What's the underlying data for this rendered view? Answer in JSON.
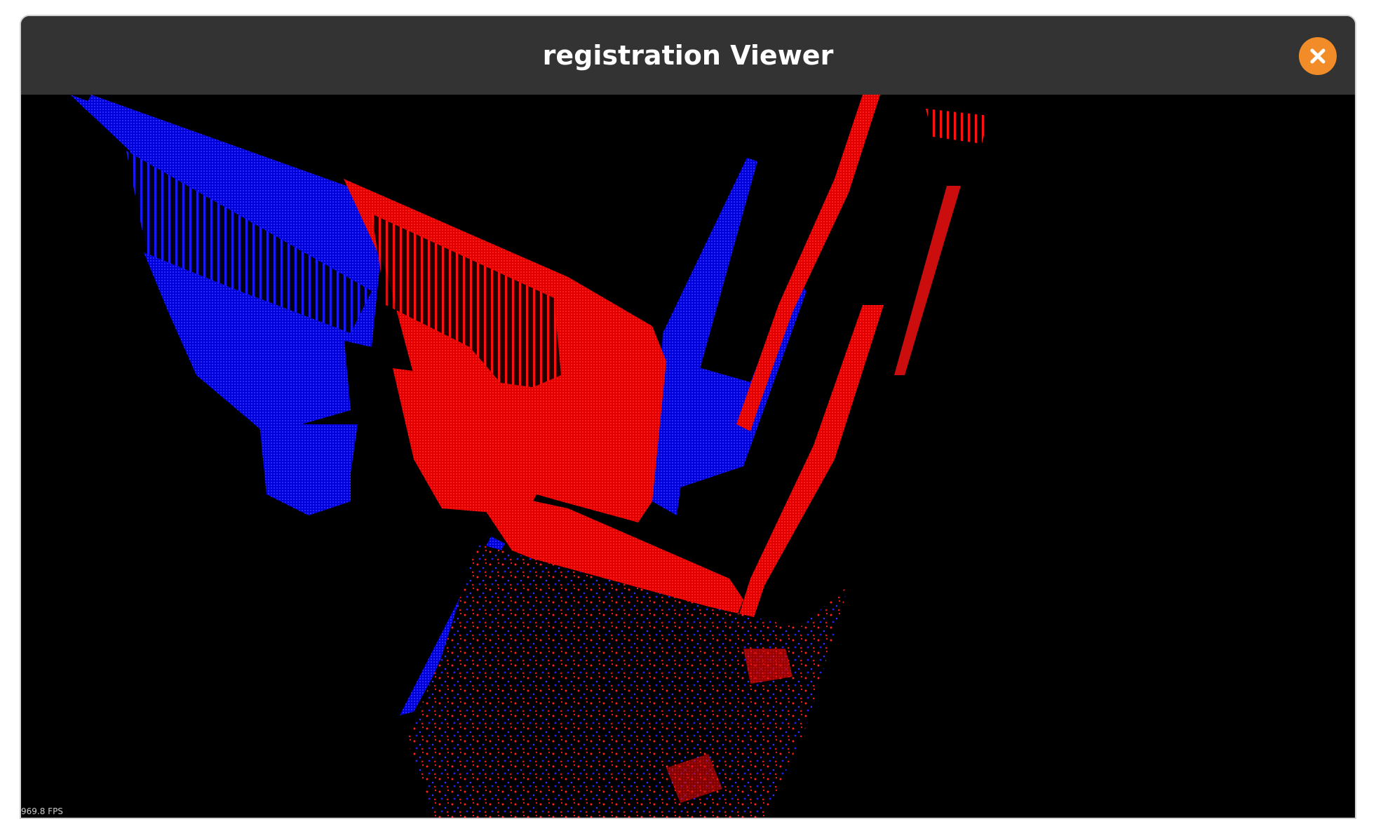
{
  "window": {
    "title": "registration Viewer",
    "close_icon": "close-icon"
  },
  "viewport": {
    "fps_text": "969.8 FPS",
    "background": "#000000",
    "source_color": "#ff0000",
    "target_color": "#0000ff"
  }
}
